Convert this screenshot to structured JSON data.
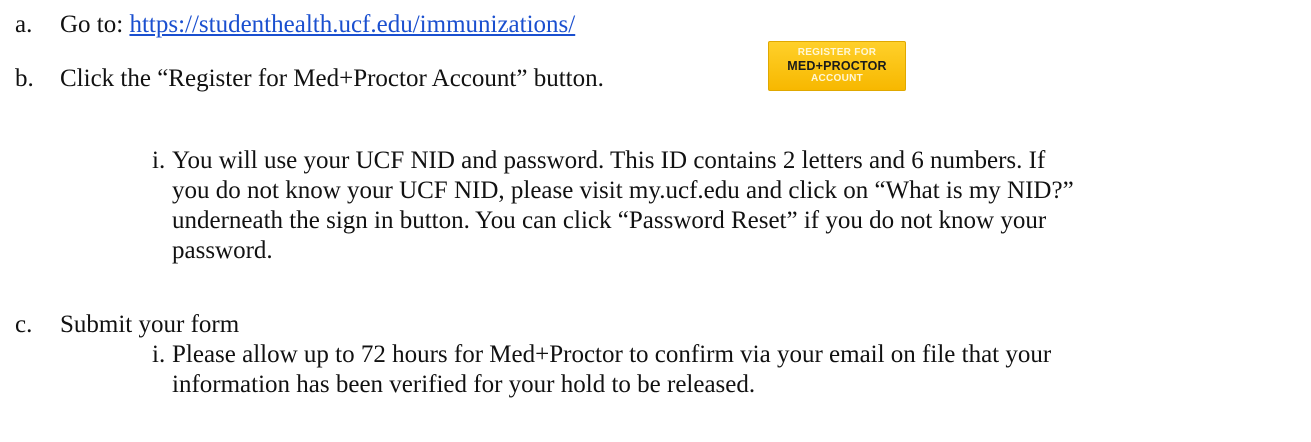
{
  "steps": {
    "a": {
      "marker": "a.",
      "text": "Go to: ",
      "link_text": "https://studenthealth.ucf.edu/immunizations/"
    },
    "b": {
      "marker": "b.",
      "text": "Click the “Register for Med+Proctor Account” button.",
      "button": {
        "line1": "REGISTER FOR",
        "line2": "MED+PROCTOR",
        "line3": "ACCOUNT"
      },
      "sub": {
        "marker": "i.",
        "lines": [
          "You will use your UCF NID and password. This ID contains 2 letters and 6 numbers. If",
          "you do not know your UCF NID, please visit my.ucf.edu and click on “What is my NID?”",
          "underneath the sign in button. You can click “Password Reset” if you do not know your",
          "password."
        ]
      }
    },
    "c": {
      "marker": "c.",
      "text": "Submit your form",
      "sub": {
        "marker": "i.",
        "lines": [
          "Please allow up to 72 hours for Med+Proctor to confirm via your email on file that your",
          "information has been verified for your hold to be released."
        ]
      }
    }
  }
}
